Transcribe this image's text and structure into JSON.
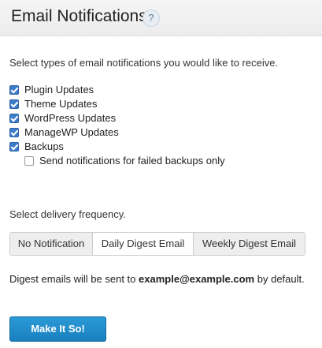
{
  "header": {
    "title": "Email Notifications",
    "help_icon": "question-mark-icon",
    "help_glyph": "?"
  },
  "intro_text": "Select types of email notifications you would like to receive.",
  "options": [
    {
      "label": "Plugin Updates",
      "checked": true
    },
    {
      "label": "Theme Updates",
      "checked": true
    },
    {
      "label": "WordPress Updates",
      "checked": true
    },
    {
      "label": "ManageWP Updates",
      "checked": true
    },
    {
      "label": "Backups",
      "checked": true
    },
    {
      "label": "Send notifications for failed backups only",
      "checked": false
    }
  ],
  "frequency": {
    "label": "Select delivery frequency.",
    "choices": [
      "No Notification",
      "Daily Digest Email",
      "Weekly Digest Email"
    ],
    "selected": "Daily Digest Email"
  },
  "digest": {
    "prefix": "Digest emails will be sent to",
    "email": "example@example.com",
    "suffix": "by default."
  },
  "submit_label": "Make It So!",
  "colors": {
    "accent": "#1f8ccd",
    "checkbox": "#3d7cc9",
    "header_bg": "#efefef"
  }
}
